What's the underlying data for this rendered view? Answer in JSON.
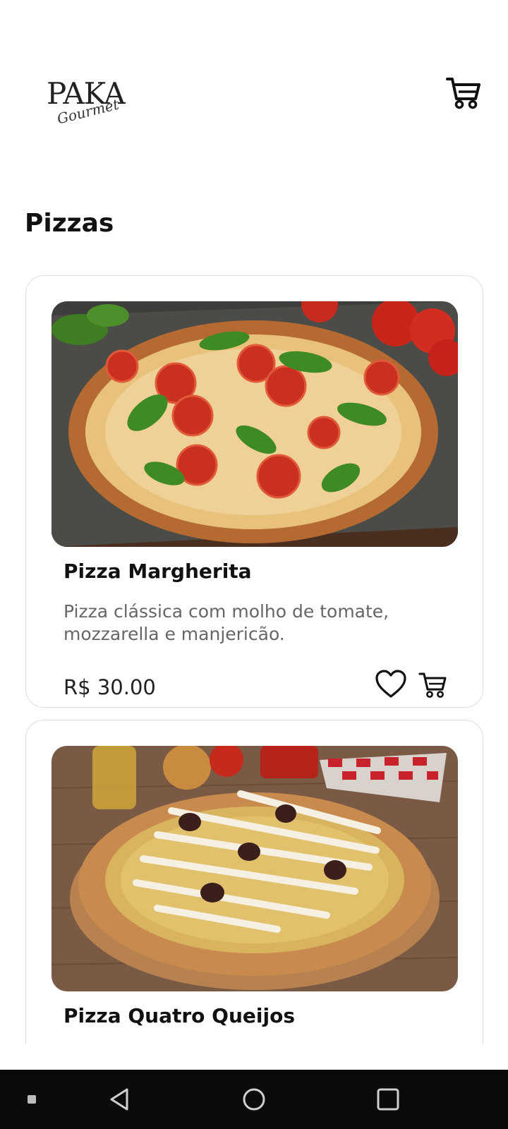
{
  "header": {
    "logo_main": "PAKA",
    "logo_script": "Gourmet",
    "cart_icon": "cart-icon"
  },
  "section": {
    "title": "Pizzas"
  },
  "products": [
    {
      "name": "Pizza Margherita",
      "description": "Pizza clássica com molho de tomate, mozzarella e manjericão.",
      "price": "R$ 30.00",
      "image": "pizza-margherita-photo",
      "favorite_icon": "heart-icon",
      "cart_icon": "cart-icon"
    },
    {
      "name": "Pizza Quatro Queijos",
      "image": "pizza-quatro-queijos-photo"
    }
  ],
  "navbar": {
    "items": [
      "square-small-icon",
      "back-triangle-icon",
      "home-circle-icon",
      "recents-square-icon"
    ]
  },
  "colors": {
    "background": "#ffffff",
    "text": "#111111",
    "muted_text": "#666666",
    "card_border": "#dedede",
    "navbar": "#0b0b0b"
  }
}
